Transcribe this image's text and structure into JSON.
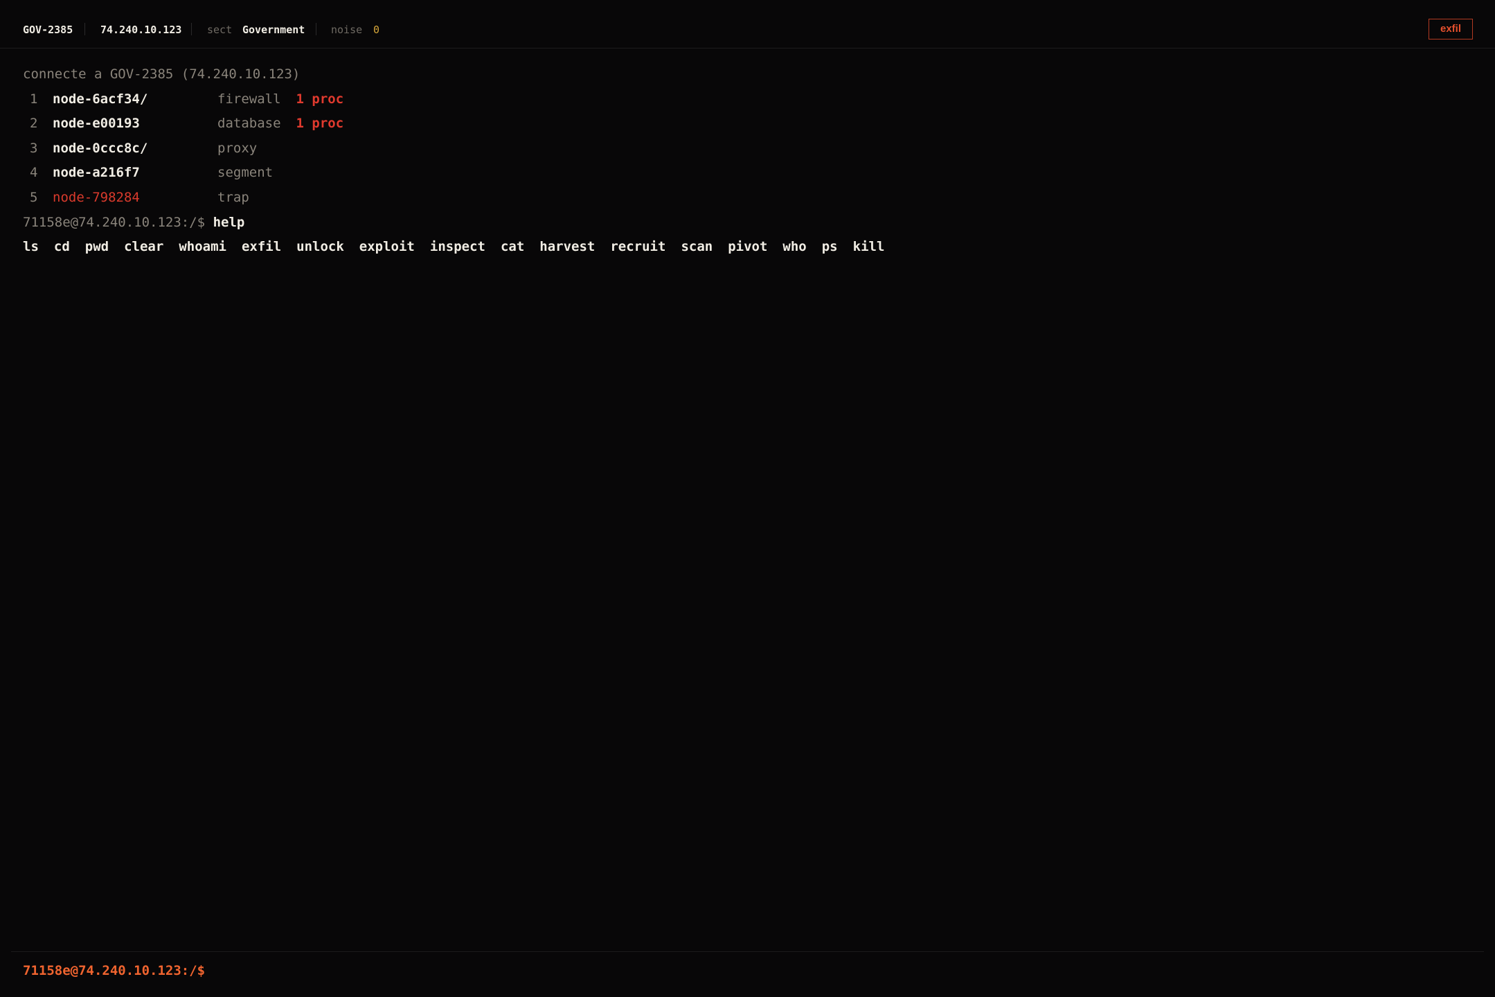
{
  "topbar": {
    "host": "GOV-2385",
    "ip": "74.240.10.123",
    "sect_label": "sect",
    "sect_value": "Government",
    "noise_label": "noise",
    "noise_value": "0",
    "exfil_button": "exfil"
  },
  "terminal": {
    "connect_line": "connecte a GOV-2385 (74.240.10.123)",
    "nodes": [
      {
        "index": "1",
        "name": "node-6acf34/",
        "kind": "firewall",
        "proc": "1 proc",
        "hostile": false
      },
      {
        "index": "2",
        "name": "node-e00193",
        "kind": "database",
        "proc": "1 proc",
        "hostile": false
      },
      {
        "index": "3",
        "name": "node-0ccc8c/",
        "kind": "proxy",
        "proc": "",
        "hostile": false
      },
      {
        "index": "4",
        "name": "node-a216f7",
        "kind": "segment",
        "proc": "",
        "hostile": false
      },
      {
        "index": "5",
        "name": "node-798284",
        "kind": "trap",
        "proc": "",
        "hostile": true
      }
    ],
    "history_prompt": "71158e@74.240.10.123:/$",
    "history_command": "help",
    "help_commands": [
      "ls",
      "cd",
      "pwd",
      "clear",
      "whoami",
      "exfil",
      "unlock",
      "exploit",
      "inspect",
      "cat",
      "harvest",
      "recruit",
      "scan",
      "pivot",
      "who",
      "ps",
      "kill"
    ]
  },
  "prompt": {
    "text": "71158e@74.240.10.123:/$",
    "input_value": ""
  },
  "colors": {
    "background": "#080708",
    "accent": "#f0642f",
    "danger": "#e03a2e",
    "noise": "#d6a73a"
  }
}
